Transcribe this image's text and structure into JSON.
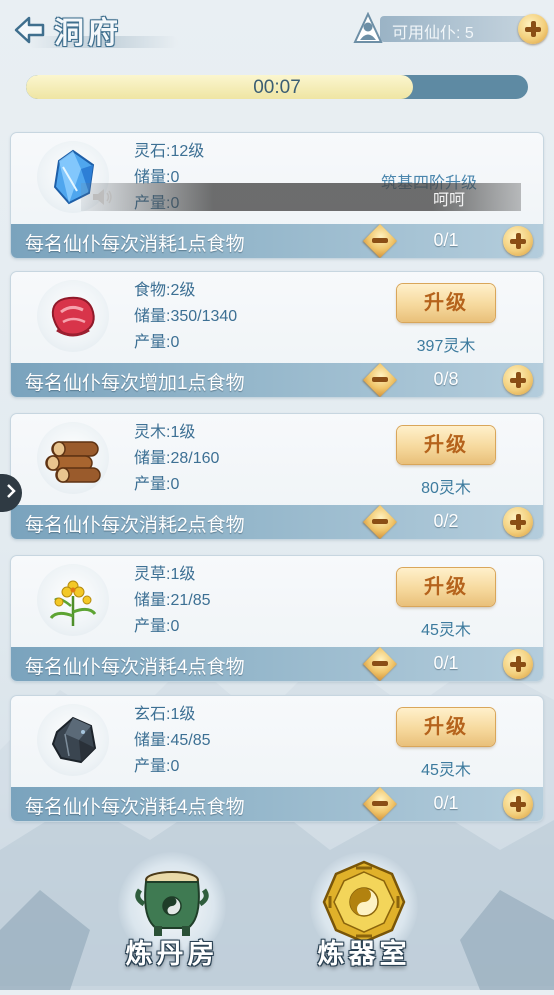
{
  "header": {
    "title": "洞府",
    "available_servants_label": "可用仙仆: 5"
  },
  "timer": {
    "text": "00:07",
    "progress": 0.77
  },
  "cards": [
    {
      "name": "灵石:12级",
      "storage": "储量:0",
      "output": "产量:0",
      "rank_label": "筑基四阶升级",
      "voice_text": "呵呵",
      "footer": "每名仙仆每次消耗1点食物",
      "count": "0/1",
      "icon": "spirit-stone-icon"
    },
    {
      "name": "食物:2级",
      "storage": "储量:350/1340",
      "output": "产量:0",
      "upgrade": "升级",
      "cost": "397灵木",
      "footer": "每名仙仆每次增加1点食物",
      "count": "0/8",
      "icon": "meat-icon"
    },
    {
      "name": "灵木:1级",
      "storage": "储量:28/160",
      "output": "产量:0",
      "upgrade": "升级",
      "cost": "80灵木",
      "footer": "每名仙仆每次消耗2点食物",
      "count": "0/2",
      "icon": "wood-logs-icon"
    },
    {
      "name": "灵草:1级",
      "storage": "储量:21/85",
      "output": "产量:0",
      "upgrade": "升级",
      "cost": "45灵木",
      "footer": "每名仙仆每次消耗4点食物",
      "count": "0/1",
      "icon": "herb-flower-icon"
    },
    {
      "name": "玄石:1级",
      "storage": "储量:45/85",
      "output": "产量:0",
      "upgrade": "升级",
      "cost": "45灵木",
      "footer": "每名仙仆每次消耗4点食物",
      "count": "0/1",
      "icon": "dark-ore-icon"
    }
  ],
  "bottom": {
    "alchemy_label": "炼丹房",
    "forge_label": "炼器室"
  },
  "colors": {
    "accent_gold": "#f3cf7c",
    "footer_blue": "#7aa3bd",
    "text_blue": "#3d7094"
  }
}
